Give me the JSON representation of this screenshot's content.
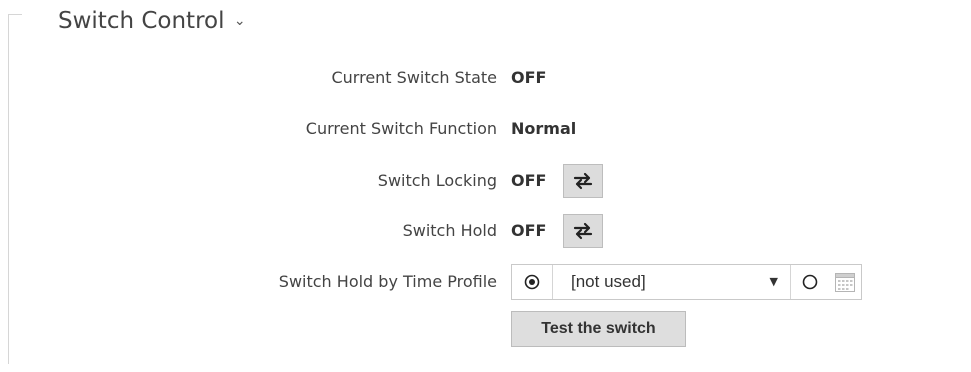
{
  "section": {
    "title": "Switch Control",
    "chevron": "⌄"
  },
  "fields": {
    "current_state": {
      "label": "Current Switch State",
      "value": "OFF"
    },
    "current_function": {
      "label": "Current Switch Function",
      "value": "Normal"
    },
    "switch_locking": {
      "label": "Switch Locking",
      "value": "OFF",
      "toggle_icon": "swap-arrows-icon"
    },
    "switch_hold": {
      "label": "Switch Hold",
      "value": "OFF",
      "toggle_icon": "swap-arrows-icon"
    },
    "hold_by_time_profile": {
      "label": "Switch Hold by Time Profile",
      "selected_option": "[not used]",
      "radio_profile_selected": true,
      "radio_custom_selected": false,
      "calendar_icon": "calendar-icon"
    }
  },
  "actions": {
    "test_switch_label": "Test the switch"
  }
}
